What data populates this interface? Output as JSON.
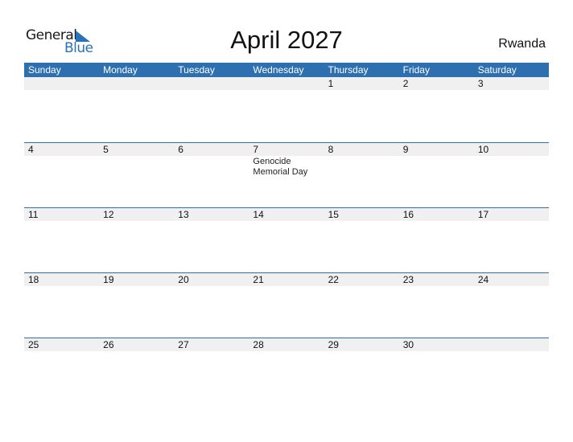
{
  "logo": {
    "word1": "General",
    "word2": "Blue"
  },
  "title": "April 2027",
  "country": "Rwanda",
  "colors": {
    "header_bg": "#2e6fb0",
    "date_strip_bg": "#f0f0f0",
    "logo_blue": "#2a72b8"
  },
  "weekdays": [
    "Sunday",
    "Monday",
    "Tuesday",
    "Wednesday",
    "Thursday",
    "Friday",
    "Saturday"
  ],
  "weeks": [
    {
      "days": [
        {
          "date": "",
          "event": ""
        },
        {
          "date": "",
          "event": ""
        },
        {
          "date": "",
          "event": ""
        },
        {
          "date": "",
          "event": ""
        },
        {
          "date": "1",
          "event": ""
        },
        {
          "date": "2",
          "event": ""
        },
        {
          "date": "3",
          "event": ""
        }
      ]
    },
    {
      "days": [
        {
          "date": "4",
          "event": ""
        },
        {
          "date": "5",
          "event": ""
        },
        {
          "date": "6",
          "event": ""
        },
        {
          "date": "7",
          "event": "Genocide Memorial Day"
        },
        {
          "date": "8",
          "event": ""
        },
        {
          "date": "9",
          "event": ""
        },
        {
          "date": "10",
          "event": ""
        }
      ]
    },
    {
      "days": [
        {
          "date": "11",
          "event": ""
        },
        {
          "date": "12",
          "event": ""
        },
        {
          "date": "13",
          "event": ""
        },
        {
          "date": "14",
          "event": ""
        },
        {
          "date": "15",
          "event": ""
        },
        {
          "date": "16",
          "event": ""
        },
        {
          "date": "17",
          "event": ""
        }
      ]
    },
    {
      "days": [
        {
          "date": "18",
          "event": ""
        },
        {
          "date": "19",
          "event": ""
        },
        {
          "date": "20",
          "event": ""
        },
        {
          "date": "21",
          "event": ""
        },
        {
          "date": "22",
          "event": ""
        },
        {
          "date": "23",
          "event": ""
        },
        {
          "date": "24",
          "event": ""
        }
      ]
    },
    {
      "days": [
        {
          "date": "25",
          "event": ""
        },
        {
          "date": "26",
          "event": ""
        },
        {
          "date": "27",
          "event": ""
        },
        {
          "date": "28",
          "event": ""
        },
        {
          "date": "29",
          "event": ""
        },
        {
          "date": "30",
          "event": ""
        },
        {
          "date": "",
          "event": ""
        }
      ]
    }
  ]
}
